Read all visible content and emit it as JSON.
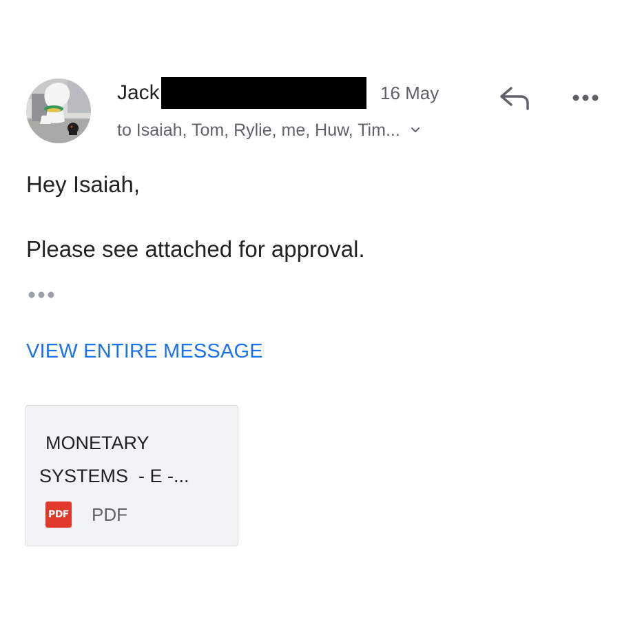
{
  "sender": {
    "name": "Jack",
    "date": "16 May",
    "recipients": "to Isaiah, Tom, Rylie, me, Huw, Tim..."
  },
  "actions": {
    "reply_icon": "reply-icon",
    "more_icon": "more-options-icon",
    "expand_icon": "chevron-down-icon"
  },
  "message": {
    "greeting": "Hey Isaiah,",
    "body": "Please see attached for approval.",
    "trimmed_content_icon": "ellipsis-icon",
    "view_entire_label": "VIEW ENTIRE MESSAGE"
  },
  "attachment": {
    "title_line1": "MONETARY",
    "title_line2": "SYSTEMS  - E -...",
    "badge": "PDF",
    "type": "PDF"
  },
  "colors": {
    "link": "#1a73e8",
    "secondary_text": "#5f6368",
    "pdf_red": "#e0392b",
    "attachment_bg": "#f1f3f4"
  }
}
